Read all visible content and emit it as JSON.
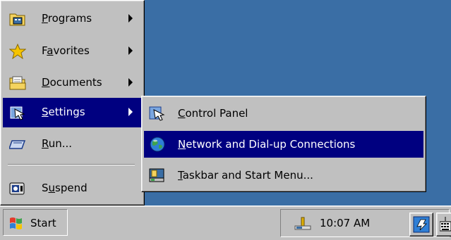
{
  "start_menu": {
    "items": [
      {
        "key": "programs",
        "pre": "",
        "acc": "P",
        "post": "rograms",
        "submenu": true,
        "icon": "folder-programs-icon"
      },
      {
        "key": "favorites",
        "pre": "F",
        "acc": "a",
        "post": "vorites",
        "submenu": true,
        "icon": "star-icon"
      },
      {
        "key": "documents",
        "pre": "",
        "acc": "D",
        "post": "ocuments",
        "submenu": true,
        "icon": "folder-documents-icon"
      },
      {
        "key": "settings",
        "pre": "",
        "acc": "S",
        "post": "ettings",
        "submenu": true,
        "selected": true,
        "icon": "settings-icon"
      },
      {
        "key": "run",
        "pre": "",
        "acc": "R",
        "post": "un...",
        "submenu": false,
        "icon": "run-icon"
      },
      {
        "key": "suspend",
        "pre": "S",
        "acc": "u",
        "post": "spend",
        "submenu": false,
        "icon": "suspend-icon"
      }
    ]
  },
  "settings_submenu": {
    "items": [
      {
        "key": "control-panel",
        "pre": "",
        "acc": "C",
        "post": "ontrol Panel",
        "icon": "control-panel-icon"
      },
      {
        "key": "network",
        "pre": "",
        "acc": "N",
        "post": "etwork and Dial-up Connections",
        "selected": true,
        "icon": "network-globe-icon"
      },
      {
        "key": "taskbar",
        "pre": "",
        "acc": "T",
        "post": "askbar and Start Menu...",
        "icon": "taskbar-icon"
      }
    ]
  },
  "taskbar": {
    "start_label": "Start",
    "clock": "10:07 AM"
  },
  "colors": {
    "desktop": "#3a6ea5",
    "selection": "#000080",
    "face": "#c0c0c0"
  }
}
